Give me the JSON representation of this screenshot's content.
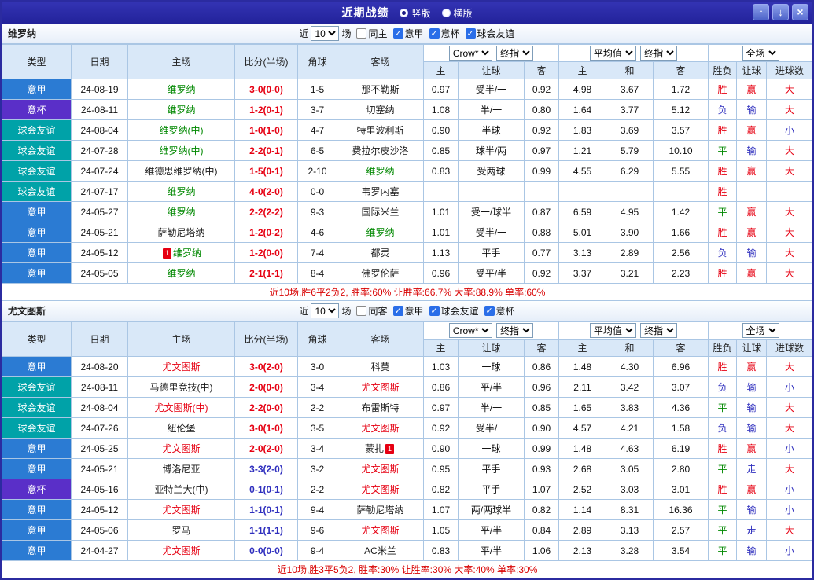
{
  "titlebar": {
    "title": "近期战绩",
    "layout_options": [
      {
        "label": "竖版",
        "selected": true
      },
      {
        "label": "横版",
        "selected": false
      }
    ],
    "buttons": {
      "up": "↑",
      "down": "↓",
      "close": "×"
    }
  },
  "league_colors": {
    "意甲": "#2b7bd3",
    "意杯": "#5a2fc8",
    "球会友谊": "#00a2a8"
  },
  "colors": {
    "red": "#e60012",
    "blue": "#2f2fbe",
    "green": "#008800",
    "black": "#1a1a1a"
  },
  "table_header": {
    "type": "类型",
    "date": "日期",
    "home": "主场",
    "score": "比分(半场)",
    "corner": "角球",
    "away": "客场",
    "odds_selects": {
      "bookmaker": "Crow*",
      "final1": "终指",
      "average": "平均值",
      "final2": "终指",
      "fulltime": "全场"
    },
    "sub": {
      "h": "主",
      "handicap": "让球",
      "a": "客",
      "h2": "主",
      "d": "和",
      "a2": "客",
      "wdl": "胜负",
      "handicap2": "让球",
      "goals": "进球数"
    }
  },
  "sections": [
    {
      "team": "维罗纳",
      "filter": {
        "near": "近",
        "count": "10",
        "games": "场",
        "same": "同主",
        "leagues": [
          "意甲",
          "意杯",
          "球会友谊"
        ]
      },
      "summary": "近10场,胜6平2负2, 胜率:60% 让胜率:66.7% 大率:88.9% 单率:60%",
      "rows": [
        {
          "league": "意甲",
          "date": "24-08-19",
          "home": {
            "name": "维罗纳",
            "color": "green"
          },
          "score": {
            "text": "3-0(0-0)",
            "color": "red"
          },
          "corner": "1-5",
          "away": {
            "name": "那不勒斯",
            "color": "black"
          },
          "odds": [
            "0.97",
            "受半/一",
            "0.92",
            "4.98",
            "3.67",
            "1.72"
          ],
          "results": [
            {
              "t": "胜",
              "c": "red"
            },
            {
              "t": "赢",
              "c": "red"
            },
            {
              "t": "大",
              "c": "red"
            }
          ]
        },
        {
          "league": "意杯",
          "date": "24-08-11",
          "home": {
            "name": "维罗纳",
            "color": "green"
          },
          "score": {
            "text": "1-2(0-1)",
            "color": "red"
          },
          "corner": "3-7",
          "away": {
            "name": "切塞纳",
            "color": "black"
          },
          "odds": [
            "1.08",
            "半/一",
            "0.80",
            "1.64",
            "3.77",
            "5.12"
          ],
          "results": [
            {
              "t": "负",
              "c": "blue"
            },
            {
              "t": "输",
              "c": "blue"
            },
            {
              "t": "大",
              "c": "red"
            }
          ]
        },
        {
          "league": "球会友谊",
          "date": "24-08-04",
          "home": {
            "name": "维罗纳(中)",
            "color": "green"
          },
          "score": {
            "text": "1-0(1-0)",
            "color": "red"
          },
          "corner": "4-7",
          "away": {
            "name": "特里波利斯",
            "color": "black"
          },
          "odds": [
            "0.90",
            "半球",
            "0.92",
            "1.83",
            "3.69",
            "3.57"
          ],
          "results": [
            {
              "t": "胜",
              "c": "red"
            },
            {
              "t": "赢",
              "c": "red"
            },
            {
              "t": "小",
              "c": "blue"
            }
          ]
        },
        {
          "league": "球会友谊",
          "date": "24-07-28",
          "home": {
            "name": "维罗纳(中)",
            "color": "green"
          },
          "score": {
            "text": "2-2(0-1)",
            "color": "red"
          },
          "corner": "6-5",
          "away": {
            "name": "费拉尔皮沙洛",
            "color": "black"
          },
          "odds": [
            "0.85",
            "球半/两",
            "0.97",
            "1.21",
            "5.79",
            "10.10"
          ],
          "results": [
            {
              "t": "平",
              "c": "green"
            },
            {
              "t": "输",
              "c": "blue"
            },
            {
              "t": "大",
              "c": "red"
            }
          ]
        },
        {
          "league": "球会友谊",
          "date": "24-07-24",
          "home": {
            "name": "维德思维罗纳(中)",
            "color": "black"
          },
          "score": {
            "text": "1-5(0-1)",
            "color": "red"
          },
          "corner": "2-10",
          "away": {
            "name": "维罗纳",
            "color": "green"
          },
          "odds": [
            "0.83",
            "受两球",
            "0.99",
            "4.55",
            "6.29",
            "5.55"
          ],
          "results": [
            {
              "t": "胜",
              "c": "red"
            },
            {
              "t": "赢",
              "c": "red"
            },
            {
              "t": "大",
              "c": "red"
            }
          ]
        },
        {
          "league": "球会友谊",
          "date": "24-07-17",
          "home": {
            "name": "维罗纳",
            "color": "green"
          },
          "score": {
            "text": "4-0(2-0)",
            "color": "red"
          },
          "corner": "0-0",
          "away": {
            "name": "韦罗内塞",
            "color": "black"
          },
          "odds": [
            "",
            "",
            "",
            "",
            "",
            ""
          ],
          "results": [
            {
              "t": "胜",
              "c": "red"
            },
            {
              "t": "",
              "c": ""
            },
            {
              "t": "",
              "c": ""
            }
          ]
        },
        {
          "league": "意甲",
          "date": "24-05-27",
          "home": {
            "name": "维罗纳",
            "color": "green"
          },
          "score": {
            "text": "2-2(2-2)",
            "color": "red"
          },
          "corner": "9-3",
          "away": {
            "name": "国际米兰",
            "color": "black"
          },
          "odds": [
            "1.01",
            "受一/球半",
            "0.87",
            "6.59",
            "4.95",
            "1.42"
          ],
          "results": [
            {
              "t": "平",
              "c": "green"
            },
            {
              "t": "赢",
              "c": "red"
            },
            {
              "t": "大",
              "c": "red"
            }
          ]
        },
        {
          "league": "意甲",
          "date": "24-05-21",
          "home": {
            "name": "萨勒尼塔纳",
            "color": "black"
          },
          "score": {
            "text": "1-2(0-2)",
            "color": "red"
          },
          "corner": "4-6",
          "away": {
            "name": "维罗纳",
            "color": "green"
          },
          "odds": [
            "1.01",
            "受半/一",
            "0.88",
            "5.01",
            "3.90",
            "1.66"
          ],
          "results": [
            {
              "t": "胜",
              "c": "red"
            },
            {
              "t": "赢",
              "c": "red"
            },
            {
              "t": "大",
              "c": "red"
            }
          ]
        },
        {
          "league": "意甲",
          "date": "24-05-12",
          "home": {
            "name": "维罗纳",
            "color": "green",
            "card": "1"
          },
          "score": {
            "text": "1-2(0-0)",
            "color": "red"
          },
          "corner": "7-4",
          "away": {
            "name": "都灵",
            "color": "black"
          },
          "odds": [
            "1.13",
            "平手",
            "0.77",
            "3.13",
            "2.89",
            "2.56"
          ],
          "results": [
            {
              "t": "负",
              "c": "blue"
            },
            {
              "t": "输",
              "c": "blue"
            },
            {
              "t": "大",
              "c": "red"
            }
          ]
        },
        {
          "league": "意甲",
          "date": "24-05-05",
          "home": {
            "name": "维罗纳",
            "color": "green"
          },
          "score": {
            "text": "2-1(1-1)",
            "color": "red"
          },
          "corner": "8-4",
          "away": {
            "name": "佛罗伦萨",
            "color": "black"
          },
          "odds": [
            "0.96",
            "受平/半",
            "0.92",
            "3.37",
            "3.21",
            "2.23"
          ],
          "results": [
            {
              "t": "胜",
              "c": "red"
            },
            {
              "t": "赢",
              "c": "red"
            },
            {
              "t": "大",
              "c": "red"
            }
          ]
        }
      ]
    },
    {
      "team": "尤文图斯",
      "filter": {
        "near": "近",
        "count": "10",
        "games": "场",
        "same": "同客",
        "leagues": [
          "意甲",
          "球会友谊",
          "意杯"
        ]
      },
      "summary": "近10场,胜3平5负2, 胜率:30% 让胜率:30% 大率:40% 单率:30%",
      "rows": [
        {
          "league": "意甲",
          "date": "24-08-20",
          "home": {
            "name": "尤文图斯",
            "color": "red"
          },
          "score": {
            "text": "3-0(2-0)",
            "color": "red"
          },
          "corner": "3-0",
          "away": {
            "name": "科莫",
            "color": "black"
          },
          "odds": [
            "1.03",
            "一球",
            "0.86",
            "1.48",
            "4.30",
            "6.96"
          ],
          "results": [
            {
              "t": "胜",
              "c": "red"
            },
            {
              "t": "赢",
              "c": "red"
            },
            {
              "t": "大",
              "c": "red"
            }
          ]
        },
        {
          "league": "球会友谊",
          "date": "24-08-11",
          "home": {
            "name": "马德里竞技(中)",
            "color": "black"
          },
          "score": {
            "text": "2-0(0-0)",
            "color": "red"
          },
          "corner": "3-4",
          "away": {
            "name": "尤文图斯",
            "color": "red"
          },
          "odds": [
            "0.86",
            "平/半",
            "0.96",
            "2.11",
            "3.42",
            "3.07"
          ],
          "results": [
            {
              "t": "负",
              "c": "blue"
            },
            {
              "t": "输",
              "c": "blue"
            },
            {
              "t": "小",
              "c": "blue"
            }
          ]
        },
        {
          "league": "球会友谊",
          "date": "24-08-04",
          "home": {
            "name": "尤文图斯(中)",
            "color": "red"
          },
          "score": {
            "text": "2-2(0-0)",
            "color": "red"
          },
          "corner": "2-2",
          "away": {
            "name": "布雷斯特",
            "color": "black"
          },
          "odds": [
            "0.97",
            "半/一",
            "0.85",
            "1.65",
            "3.83",
            "4.36"
          ],
          "results": [
            {
              "t": "平",
              "c": "green"
            },
            {
              "t": "输",
              "c": "blue"
            },
            {
              "t": "大",
              "c": "red"
            }
          ]
        },
        {
          "league": "球会友谊",
          "date": "24-07-26",
          "home": {
            "name": "纽伦堡",
            "color": "black"
          },
          "score": {
            "text": "3-0(1-0)",
            "color": "red"
          },
          "corner": "3-5",
          "away": {
            "name": "尤文图斯",
            "color": "red"
          },
          "odds": [
            "0.92",
            "受半/一",
            "0.90",
            "4.57",
            "4.21",
            "1.58"
          ],
          "results": [
            {
              "t": "负",
              "c": "blue"
            },
            {
              "t": "输",
              "c": "blue"
            },
            {
              "t": "大",
              "c": "red"
            }
          ]
        },
        {
          "league": "意甲",
          "date": "24-05-25",
          "home": {
            "name": "尤文图斯",
            "color": "red"
          },
          "score": {
            "text": "2-0(2-0)",
            "color": "red"
          },
          "corner": "3-4",
          "away": {
            "name": "蒙扎",
            "color": "black",
            "card": "1"
          },
          "odds": [
            "0.90",
            "一球",
            "0.99",
            "1.48",
            "4.63",
            "6.19"
          ],
          "results": [
            {
              "t": "胜",
              "c": "red"
            },
            {
              "t": "赢",
              "c": "red"
            },
            {
              "t": "小",
              "c": "blue"
            }
          ]
        },
        {
          "league": "意甲",
          "date": "24-05-21",
          "home": {
            "name": "博洛尼亚",
            "color": "black"
          },
          "score": {
            "text": "3-3(2-0)",
            "color": "blue"
          },
          "corner": "3-2",
          "away": {
            "name": "尤文图斯",
            "color": "red"
          },
          "odds": [
            "0.95",
            "平手",
            "0.93",
            "2.68",
            "3.05",
            "2.80"
          ],
          "results": [
            {
              "t": "平",
              "c": "green"
            },
            {
              "t": "走",
              "c": "blue"
            },
            {
              "t": "大",
              "c": "red"
            }
          ]
        },
        {
          "league": "意杯",
          "date": "24-05-16",
          "home": {
            "name": "亚特兰大(中)",
            "color": "black"
          },
          "score": {
            "text": "0-1(0-1)",
            "color": "blue"
          },
          "corner": "2-2",
          "away": {
            "name": "尤文图斯",
            "color": "red"
          },
          "odds": [
            "0.82",
            "平手",
            "1.07",
            "2.52",
            "3.03",
            "3.01"
          ],
          "results": [
            {
              "t": "胜",
              "c": "red"
            },
            {
              "t": "赢",
              "c": "red"
            },
            {
              "t": "小",
              "c": "blue"
            }
          ]
        },
        {
          "league": "意甲",
          "date": "24-05-12",
          "home": {
            "name": "尤文图斯",
            "color": "red"
          },
          "score": {
            "text": "1-1(0-1)",
            "color": "blue"
          },
          "corner": "9-4",
          "away": {
            "name": "萨勒尼塔纳",
            "color": "black"
          },
          "odds": [
            "1.07",
            "两/两球半",
            "0.82",
            "1.14",
            "8.31",
            "16.36"
          ],
          "results": [
            {
              "t": "平",
              "c": "green"
            },
            {
              "t": "输",
              "c": "blue"
            },
            {
              "t": "小",
              "c": "blue"
            }
          ]
        },
        {
          "league": "意甲",
          "date": "24-05-06",
          "home": {
            "name": "罗马",
            "color": "black"
          },
          "score": {
            "text": "1-1(1-1)",
            "color": "blue"
          },
          "corner": "9-6",
          "away": {
            "name": "尤文图斯",
            "color": "red"
          },
          "odds": [
            "1.05",
            "平/半",
            "0.84",
            "2.89",
            "3.13",
            "2.57"
          ],
          "results": [
            {
              "t": "平",
              "c": "green"
            },
            {
              "t": "走",
              "c": "blue"
            },
            {
              "t": "大",
              "c": "red"
            }
          ]
        },
        {
          "league": "意甲",
          "date": "24-04-27",
          "home": {
            "name": "尤文图斯",
            "color": "red"
          },
          "score": {
            "text": "0-0(0-0)",
            "color": "blue"
          },
          "corner": "9-4",
          "away": {
            "name": "AC米兰",
            "color": "black"
          },
          "odds": [
            "0.83",
            "平/半",
            "1.06",
            "2.13",
            "3.28",
            "3.54"
          ],
          "results": [
            {
              "t": "平",
              "c": "green"
            },
            {
              "t": "输",
              "c": "blue"
            },
            {
              "t": "小",
              "c": "blue"
            }
          ]
        }
      ]
    }
  ]
}
